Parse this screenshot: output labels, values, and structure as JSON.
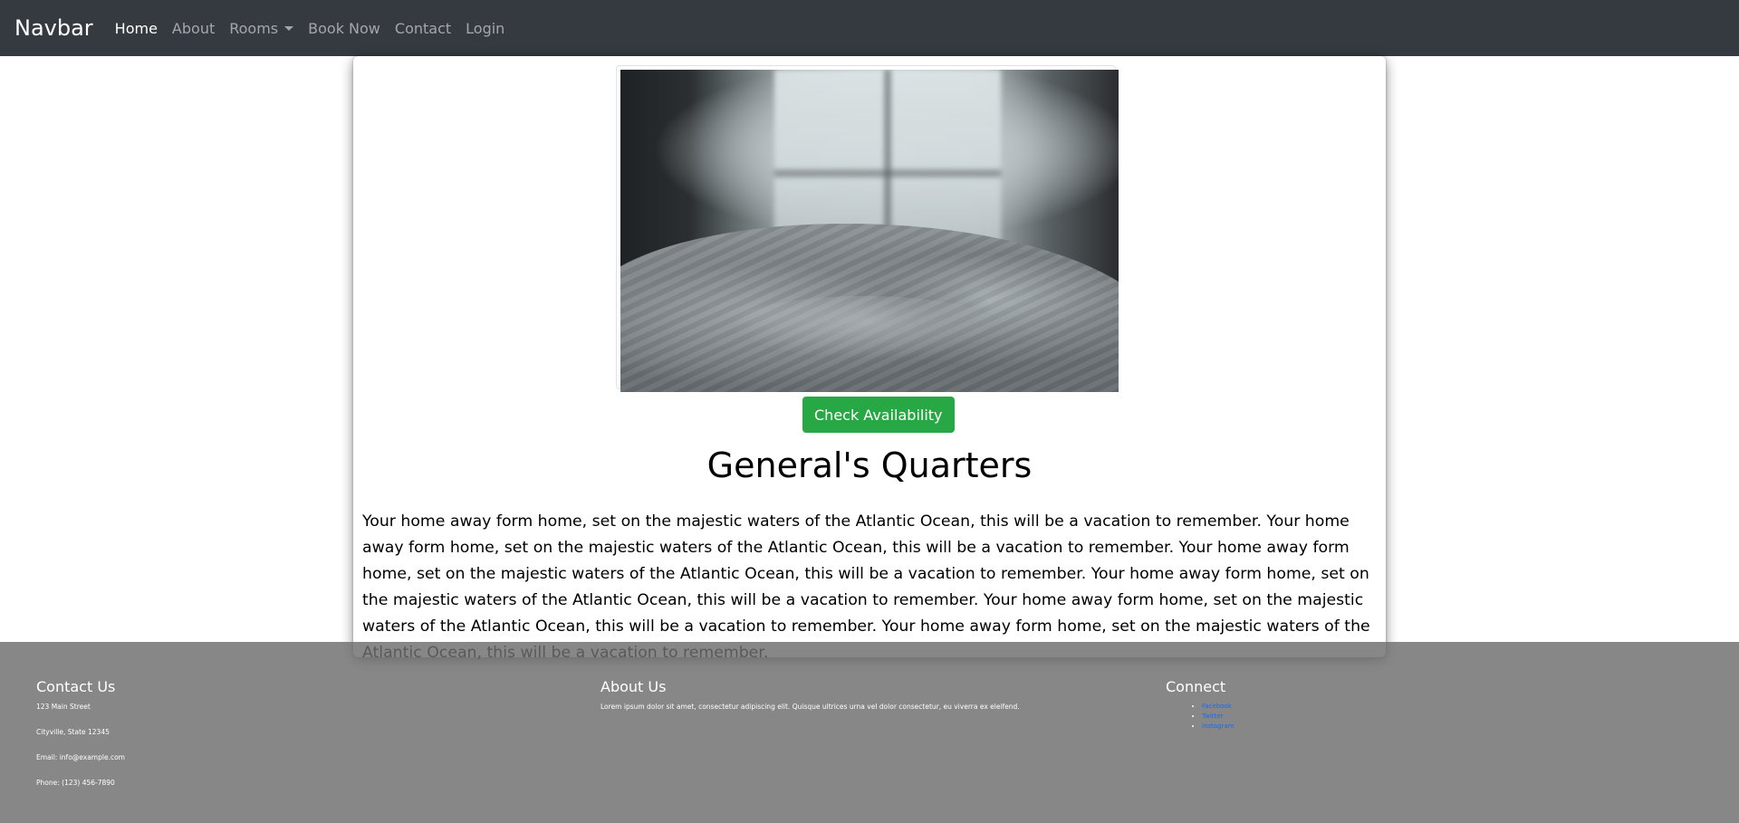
{
  "navbar": {
    "brand": "Navbar",
    "links": [
      "Home",
      "About",
      "Rooms",
      "Book Now",
      "Contact",
      "Login"
    ]
  },
  "card": {
    "button_label": "Check Availability",
    "title": "General's Quarters",
    "description": "Your home away form home, set on the majestic waters of the Atlantic Ocean, this will be a vacation to remember. Your home away form home, set on the majestic waters of the Atlantic Ocean, this will be a vacation to remember. Your home away form home, set on the majestic waters of the Atlantic Ocean, this will be a vacation to remember. Your home away form home, set on the majestic waters of the Atlantic Ocean, this will be a vacation to remember. Your home away form home, set on the majestic waters of the Atlantic Ocean, this will be a vacation to remember. Your home away form home, set on the majestic waters of the Atlantic Ocean, this will be a vacation to remember."
  },
  "footer": {
    "contact": {
      "heading": "Contact Us",
      "lines": [
        "123 Main Street",
        "Cityville, State 12345",
        "Email: info@example.com",
        "Phone: (123) 456-7890"
      ]
    },
    "about": {
      "heading": "About Us",
      "text": "Lorem ipsum dolor sit amet, consectetur adipiscing elit. Quisque ultrices urna vel dolor consectetur, eu viverra ex eleifend."
    },
    "connect": {
      "heading": "Connect",
      "links": [
        "Facebook",
        "Twitter",
        "Instagram"
      ]
    }
  },
  "colors": {
    "navbar_bg": "#343a40",
    "success": "#28a745",
    "link": "#0d6efd",
    "footer_bg": "#858585"
  }
}
